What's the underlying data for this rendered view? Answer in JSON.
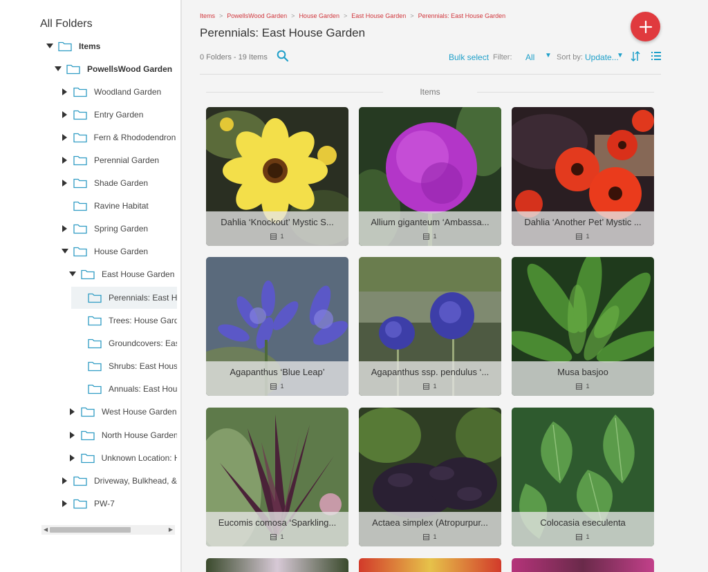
{
  "sidebar": {
    "title": "All Folders",
    "tree": [
      {
        "label": "Items"
      },
      {
        "label": "PowellsWood Garden"
      },
      {
        "label": "Woodland Garden"
      },
      {
        "label": "Entry Garden"
      },
      {
        "label": "Fern & Rhododendron I"
      },
      {
        "label": "Perennial Garden"
      },
      {
        "label": "Shade Garden"
      },
      {
        "label": "Ravine Habitat"
      },
      {
        "label": "Spring Garden"
      },
      {
        "label": "House Garden"
      },
      {
        "label": "East House Garden"
      },
      {
        "label": "Perennials: East Ho"
      },
      {
        "label": "Trees: House Gard"
      },
      {
        "label": "Groundcovers: Eas"
      },
      {
        "label": "Shrubs: East Hous"
      },
      {
        "label": "Annuals: East Hous"
      },
      {
        "label": "West House Garden"
      },
      {
        "label": "North House Garden"
      },
      {
        "label": "Unknown Location: H"
      },
      {
        "label": "Driveway, Bulkhead, &"
      },
      {
        "label": "PW-7"
      }
    ]
  },
  "breadcrumb": [
    "Items",
    "PowellsWood Garden",
    "House Garden",
    "East House Garden",
    "Perennials: East House Garden"
  ],
  "breadcrumb_sep": ">",
  "page_title": "Perennials: East House Garden",
  "counts": "0 Folders - 19 Items",
  "toolbar": {
    "bulk_select": "Bulk select",
    "filter_label": "Filter:",
    "filter_value": "All",
    "sort_label": "Sort by:",
    "sort_value": "Update..."
  },
  "section_label": "Items",
  "cards": [
    {
      "name": "Dahlia ‘Knockout’ Mystic S...",
      "count": "1"
    },
    {
      "name": "Allium giganteum ‘Ambassa...",
      "count": "1"
    },
    {
      "name": "Dahlia ‘Another Pet’ Mystic ...",
      "count": "1"
    },
    {
      "name": "Agapanthus ‘Blue Leap’",
      "count": "1"
    },
    {
      "name": "Agapanthus ssp. pendulus ‘...",
      "count": "1"
    },
    {
      "name": "Musa basjoo",
      "count": "1"
    },
    {
      "name": "Eucomis comosa ‘Sparkling...",
      "count": "1"
    },
    {
      "name": "Actaea simplex (Atropurpur...",
      "count": "1"
    },
    {
      "name": "Colocasia eseculenta",
      "count": "1"
    }
  ],
  "colors": {
    "accent": "#1e9fc9",
    "add_button": "#e03a3e",
    "breadcrumb": "#d0353b"
  },
  "icons": {
    "add": "plus-icon",
    "search": "search-icon",
    "sort_direction": "sort-direction-icon",
    "view": "list-view-icon",
    "folder": "folder-icon",
    "stack": "stack-icon"
  }
}
